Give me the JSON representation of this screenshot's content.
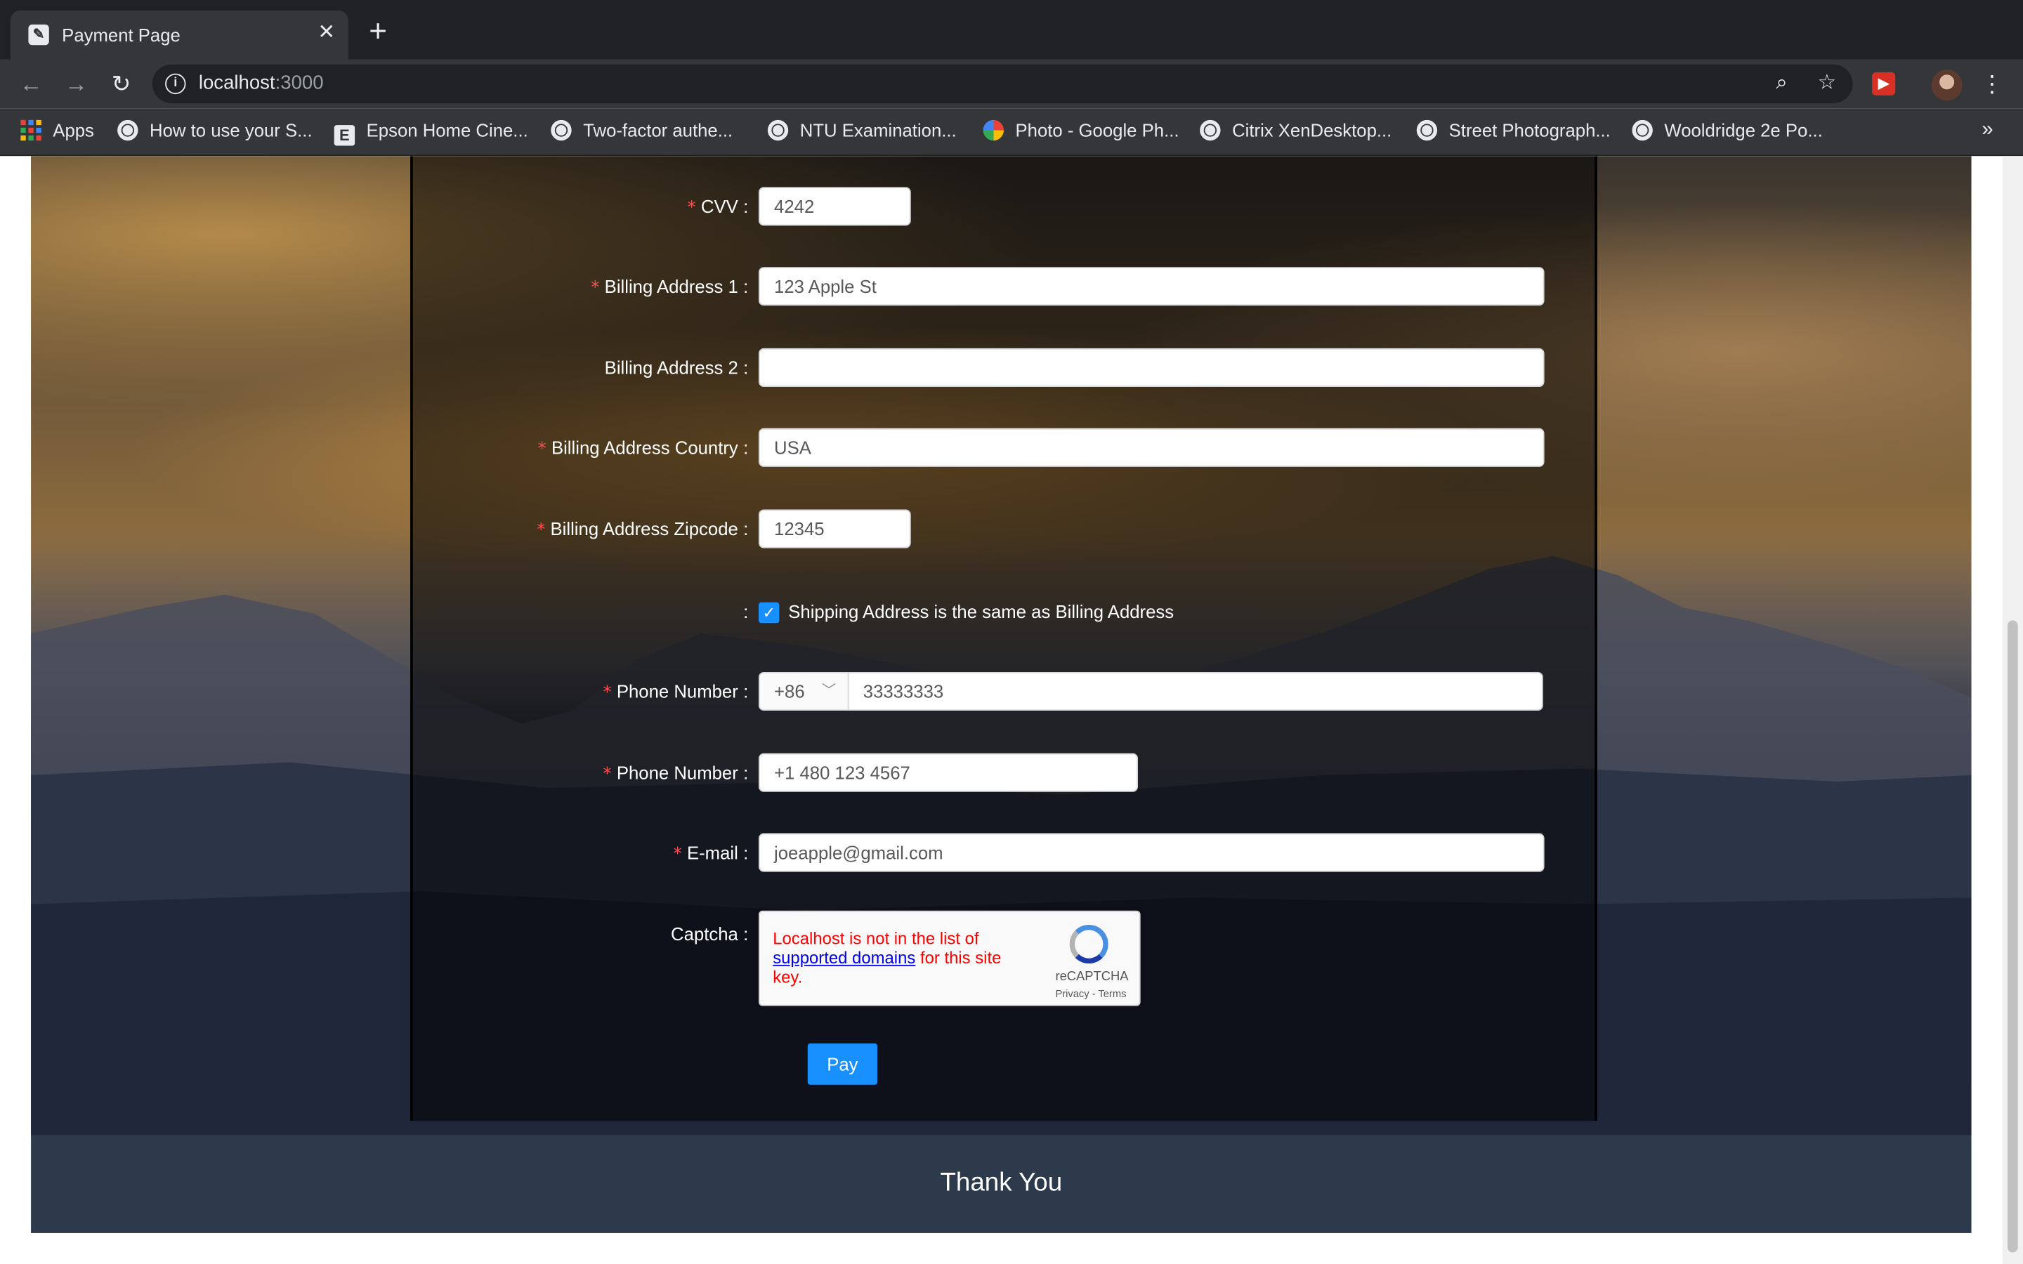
{
  "browser": {
    "tab_title": "Payment Page",
    "url_host": "localhost",
    "url_port": ":3000",
    "bookmarks": [
      "Apps",
      "How to use your S...",
      "Epson Home Cine...",
      "Two-factor authe...",
      "NTU Examination...",
      "Photo - Google Ph...",
      "Citrix XenDesktop...",
      "Street Photograph...",
      "Wooldridge 2e Po..."
    ],
    "bookmarks_more": "»"
  },
  "form": {
    "cvv": {
      "label": "CVV",
      "value": "4242"
    },
    "billing_address_1": {
      "label": "Billing Address 1",
      "value": "123 Apple St"
    },
    "billing_address_2": {
      "label": "Billing Address 2",
      "value": ""
    },
    "billing_country": {
      "label": "Billing Address Country",
      "value": "USA"
    },
    "billing_zipcode": {
      "label": "Billing Address Zipcode",
      "value": "12345"
    },
    "shipping_same": {
      "label": "Shipping Address is the same as Billing Address",
      "checked": true
    },
    "phone_1": {
      "label": "Phone Number",
      "country_code": "+86",
      "value": "33333333"
    },
    "phone_2": {
      "label": "Phone Number",
      "value": "+1 480 123 4567"
    },
    "email": {
      "label": "E-mail",
      "value": "joeapple@gmail.com"
    },
    "captcha": {
      "label": "Captcha",
      "message_prefix": "Localhost is not in the list of ",
      "message_link": "supported domains",
      "message_suffix": " for this site key.",
      "brand": "reCAPTCHA",
      "links": "Privacy - Terms"
    },
    "pay_label": "Pay"
  },
  "footer": {
    "text": "Thank You"
  },
  "colors": {
    "accent": "#1890ff",
    "required": "#ff4d4f",
    "footer_bg": "#2c3a4c"
  }
}
